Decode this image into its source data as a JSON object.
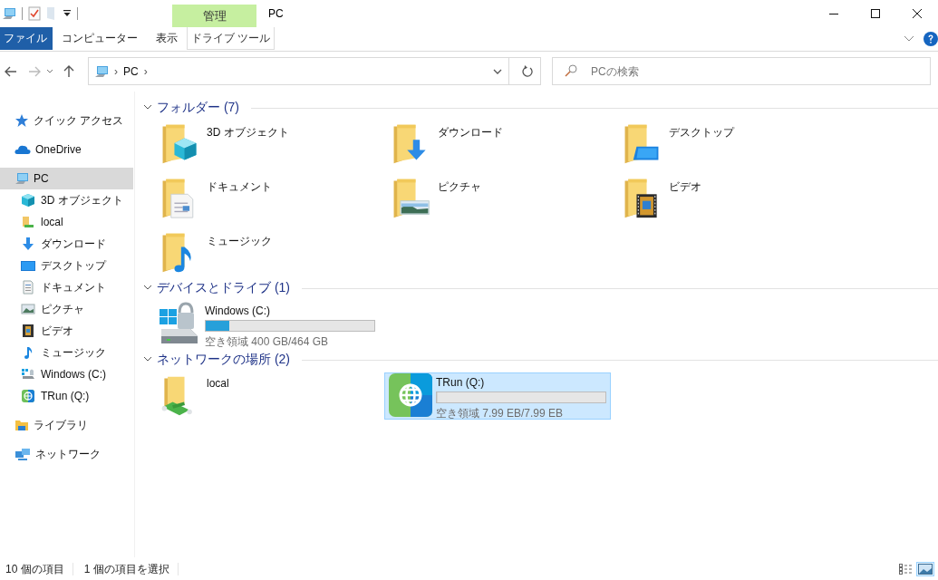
{
  "window": {
    "title": "PC",
    "context_tab": "管理"
  },
  "ribbon": {
    "tabs": [
      {
        "label": "ファイル",
        "kind": "file",
        "selected": false
      },
      {
        "label": "コンピューター",
        "kind": "plain",
        "selected": false
      },
      {
        "label": "表示",
        "kind": "plain",
        "selected": false
      },
      {
        "label": "ドライブ ツール",
        "kind": "context",
        "selected": false
      }
    ]
  },
  "address": {
    "path": [
      "PC"
    ],
    "separator": "›",
    "search": {
      "placeholder": "PCの検索"
    }
  },
  "nav": {
    "items": [
      {
        "label": "クイック アクセス",
        "selected": false
      },
      {
        "label": "OneDrive",
        "selected": false
      },
      {
        "label": "PC",
        "selected": true,
        "expanded": true,
        "children": [
          {
            "label": "3D オブジェクト",
            "selected": false
          },
          {
            "label": "local",
            "selected": false
          },
          {
            "label": "ダウンロード",
            "selected": false
          },
          {
            "label": "デスクトップ",
            "selected": false
          },
          {
            "label": "ドキュメント",
            "selected": false
          },
          {
            "label": "ピクチャ",
            "selected": false
          },
          {
            "label": "ビデオ",
            "selected": false
          },
          {
            "label": "ミュージック",
            "selected": false
          },
          {
            "label": "Windows (C:)",
            "selected": false
          },
          {
            "label": "TRun (Q:)",
            "selected": false
          }
        ]
      },
      {
        "label": "ライブラリ",
        "selected": false
      },
      {
        "label": "ネットワーク",
        "selected": false
      }
    ]
  },
  "content": {
    "sections": [
      {
        "title": "フォルダー (7)",
        "expanded": true,
        "items": [
          {
            "kind": "folder",
            "name": "3D オブジェクト",
            "selected": false
          },
          {
            "kind": "folder",
            "name": "ダウンロード",
            "selected": false
          },
          {
            "kind": "folder",
            "name": "デスクトップ",
            "selected": false
          },
          {
            "kind": "folder",
            "name": "ドキュメント",
            "selected": false
          },
          {
            "kind": "folder",
            "name": "ピクチャ",
            "selected": false
          },
          {
            "kind": "folder",
            "name": "ビデオ",
            "selected": false
          },
          {
            "kind": "folder",
            "name": "ミュージック",
            "selected": false
          }
        ]
      },
      {
        "title": "デバイスとドライブ (1)",
        "expanded": true,
        "items": [
          {
            "kind": "drive",
            "name": "Windows (C:)",
            "level": 0.14,
            "free": "空き領域 400 GB/464 GB",
            "selected": false
          }
        ]
      },
      {
        "title": "ネットワークの場所 (2)",
        "expanded": true,
        "items": [
          {
            "kind": "folder",
            "name": "local",
            "selected": false
          },
          {
            "kind": "drive",
            "name": "TRun (Q:)",
            "level": 0,
            "free": "空き領域 7.99 EB/7.99 EB",
            "selected": true
          }
        ]
      }
    ]
  },
  "status_bar": {
    "count": "10 個の項目",
    "selection": "1 個の項目を選択",
    "views": [
      {
        "selected": false
      },
      {
        "selected": true
      }
    ]
  }
}
